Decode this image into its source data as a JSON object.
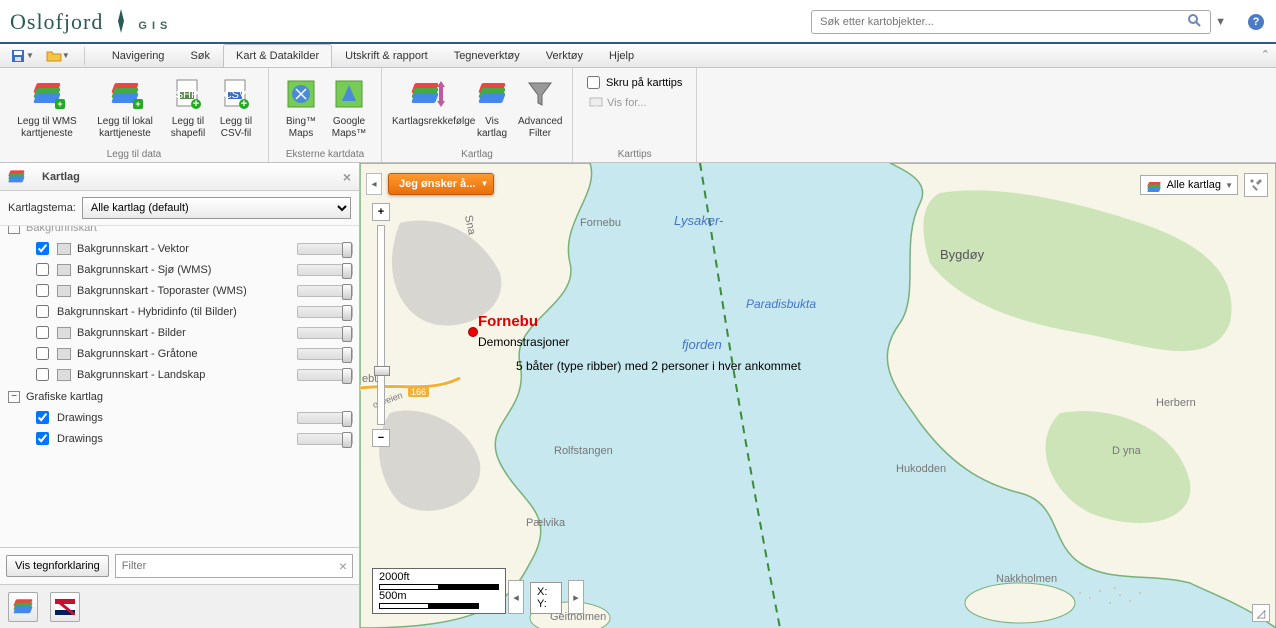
{
  "app": {
    "title": "Oslofjord GIS",
    "title_highlight": "G I S"
  },
  "search": {
    "placeholder": "Søk etter kartobjekter..."
  },
  "quick": {
    "navigering": "Navigering",
    "sok": "Søk"
  },
  "tabs": {
    "active": "Kart & Datakilder",
    "others": [
      "Utskrift & rapport",
      "Tegneverktøy",
      "Verktøy",
      "Hjelp"
    ]
  },
  "ribbon": {
    "group1": {
      "label": "Legg til data",
      "items": [
        {
          "label": "Legg til WMS karttjeneste"
        },
        {
          "label": "Legg til lokal karttjeneste"
        },
        {
          "label": "Legg til shapefil"
        },
        {
          "label": "Legg til CSV-fil"
        }
      ]
    },
    "group2": {
      "label": "Eksterne kartdata",
      "items": [
        {
          "label": "Bing™ Maps"
        },
        {
          "label": "Google Maps™"
        }
      ]
    },
    "group3": {
      "label": "Kartlag",
      "items": [
        {
          "label": "Kartlagsrekkefølge"
        },
        {
          "label": "Vis kartlag"
        },
        {
          "label": "Advanced Filter"
        }
      ]
    },
    "group4": {
      "label": "Karttips",
      "checkbox": "Skru på karttips",
      "link": "Vis for..."
    }
  },
  "panel": {
    "title": "Kartlag",
    "theme_label": "Kartlagstema:",
    "theme_value": "Alle kartlag (default)",
    "group_bg_obscured": "Bakgrunnskart",
    "bg_layers": [
      {
        "label": "Bakgrunnskart - Vektor",
        "checked": true
      },
      {
        "label": "Bakgrunnskart - Sjø (WMS)",
        "checked": false
      },
      {
        "label": "Bakgrunnskart - Toporaster (WMS)",
        "checked": false
      },
      {
        "label": "Bakgrunnskart - Hybridinfo (til Bilder)",
        "checked": false,
        "noSwatch": true
      },
      {
        "label": "Bakgrunnskart - Bilder",
        "checked": false
      },
      {
        "label": "Bakgrunnskart - Gråtone",
        "checked": false
      },
      {
        "label": "Bakgrunnskart - Landskap",
        "checked": false
      }
    ],
    "group_gfx": "Grafiske kartlag",
    "gfx_layers": [
      {
        "label": "Drawings",
        "checked": true
      },
      {
        "label": "Drawings",
        "checked": true
      }
    ],
    "legend_btn": "Vis tegnforklaring",
    "filter_placeholder": "Filter"
  },
  "map": {
    "jeg_btn": "Jeg ønsker å...",
    "alle_kartlag": "Alle kartlag",
    "labels": {
      "fornebu_small": "Fornebu",
      "ebu": "ebu",
      "lysaker": "Lysaker-",
      "fjorden": "fjorden",
      "paradisbukta": "Paradisbukta",
      "bygdoy": "Bygdøy",
      "rolfstangen": "Rolfstangen",
      "paelvika": "Pælvika",
      "hukodden": "Hukodden",
      "dyna": "D yna",
      "herbern": "Herbern",
      "nakkholmen": "Nakkholmen",
      "geitholmen": "Geitholmen",
      "sna": "Sna",
      "road": "oyveien",
      "road_no": "166"
    },
    "marker": {
      "title": "Fornebu",
      "sub": "Demonstrasjoner",
      "desc": "5 båter (type ribber) med 2 personer i hver ankommet"
    },
    "scale": {
      "ft": "2000ft",
      "m": "500m"
    },
    "coord": {
      "x": "X:",
      "y": "Y:"
    }
  }
}
